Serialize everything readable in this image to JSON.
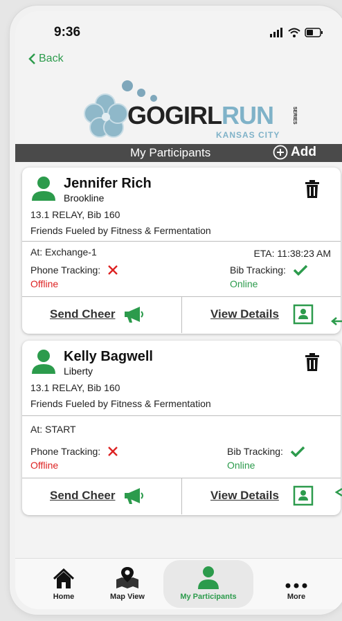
{
  "status": {
    "time": "9:36"
  },
  "nav": {
    "back_label": "Back"
  },
  "logo": {
    "go_girl": "GOGIRL",
    "run": "RUN",
    "series": "SERIES",
    "city": "KANSAS CITY"
  },
  "header": {
    "title": "My Participants",
    "add_label": "Add"
  },
  "participants": [
    {
      "name": "Jennifer Rich",
      "location": "Brookline",
      "race": "13.1 RELAY, Bib 160",
      "team": "Friends Fueled by Fitness & Fermentation",
      "at": "At: Exchange-1",
      "eta": "ETA: 11:38:23 AM",
      "phone_label": "Phone Tracking:",
      "phone_status": "Offline",
      "bib_label": "Bib Tracking:",
      "bib_status": "Online",
      "cheer_label": "Send Cheer",
      "details_label": "View Details"
    },
    {
      "name": "Kelly Bagwell",
      "location": "Liberty",
      "race": "13.1 RELAY, Bib 160",
      "team": "Friends Fueled by Fitness & Fermentation",
      "at": "At: START",
      "phone_label": "Phone Tracking:",
      "phone_status": "Offline",
      "bib_label": "Bib Tracking:",
      "bib_status": "Online",
      "cheer_label": "Send Cheer",
      "details_label": "View Details"
    }
  ],
  "tabs": [
    {
      "label": "Home",
      "icon": "home-icon"
    },
    {
      "label": "Map View",
      "icon": "map-pin-icon"
    },
    {
      "label": "My Participants",
      "icon": "person-icon",
      "active": true
    },
    {
      "label": "More",
      "icon": "more-icon"
    }
  ],
  "colors": {
    "accent": "#2c9b4c",
    "error": "#dd2222",
    "header": "#4a4a4a",
    "logo_blue": "#7fb2c8"
  }
}
